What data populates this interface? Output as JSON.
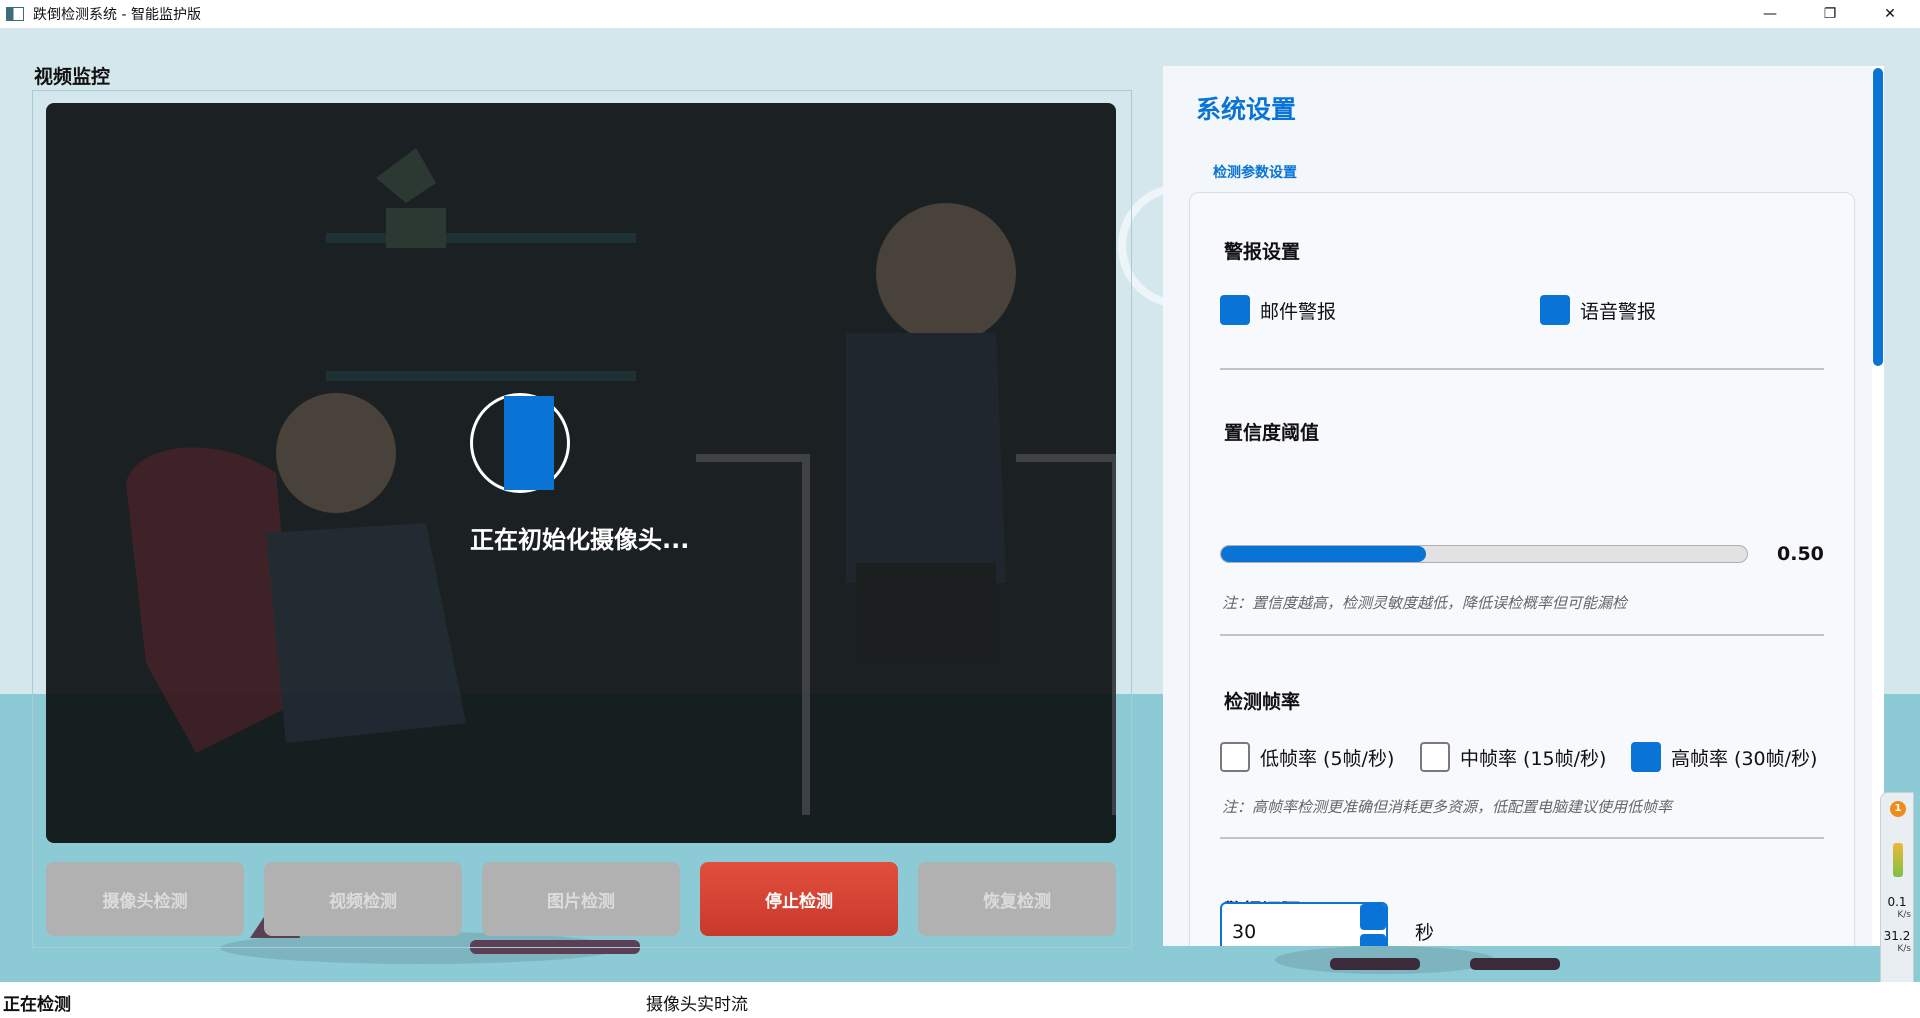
{
  "window": {
    "title": "跌倒检测系统 - 智能监护版",
    "minimize_glyph": "—",
    "restore_glyph": "❐",
    "close_glyph": "✕"
  },
  "video": {
    "section_title": "视频监控",
    "loading_text": "正在初始化摄像头..."
  },
  "buttons": {
    "camera": "摄像头检测",
    "video": "视频检测",
    "image": "图片检测",
    "stop": "停止检测",
    "resume": "恢复检测"
  },
  "settings": {
    "title": "系统设置",
    "group_label": "检测参数设置",
    "alarm": {
      "title": "警报设置",
      "email": {
        "label": "邮件警报",
        "checked": true
      },
      "voice": {
        "label": "语音警报",
        "checked": true
      }
    },
    "confidence": {
      "title": "置信度阈值",
      "value_text": "0.50",
      "slider_fraction": 0.39,
      "note": "注：置信度越高，检测灵敏度越低，降低误检概率但可能漏检"
    },
    "framerate": {
      "title": "检测帧率",
      "low": {
        "label": "低帧率 (5帧/秒)",
        "checked": false
      },
      "mid": {
        "label": "中帧率 (15帧/秒)",
        "checked": false
      },
      "high": {
        "label": "高帧率 (30帧/秒)",
        "checked": true
      },
      "note": "注：高帧率检测更准确但消耗更多资源，低配置电脑建议使用低帧率"
    },
    "interval": {
      "title": "警报间隔",
      "value": "30",
      "unit": "秒"
    }
  },
  "statusbar": {
    "status": "正在检测",
    "source": "摄像头实时流"
  },
  "net_widget": {
    "badge": "1",
    "upload_value": "0.1",
    "upload_unit": "K/s",
    "download_value": "31.2",
    "download_unit": "K/s"
  },
  "colors": {
    "accent": "#0a74d6",
    "stop_button": "#d84332",
    "disabled_button": "#b1b1b1"
  }
}
